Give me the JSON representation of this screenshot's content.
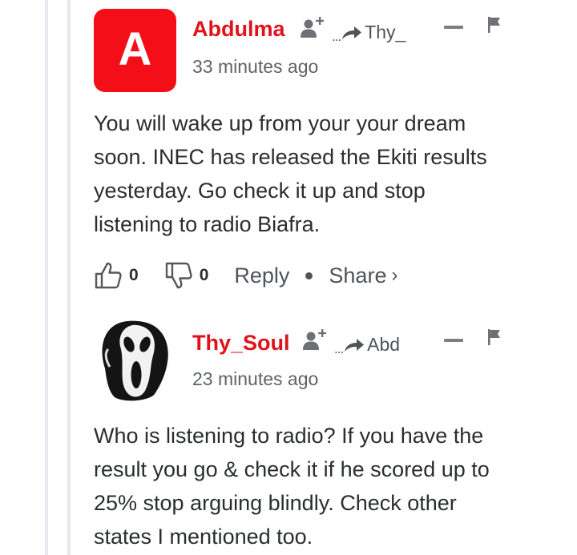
{
  "comments": [
    {
      "avatar_letter": "A",
      "username": "Abdulma",
      "reply_to": "Thy_",
      "timestamp": "33 minutes ago",
      "lines": [
        "You will wake up from your your dream",
        "soon. INEC has released the Ekiti results",
        "yesterday. Go check it up and stop",
        "listening to radio Biafra."
      ],
      "upvotes": "0",
      "downvotes": "0",
      "reply_label": "Reply",
      "share_label": "Share",
      "share_chevron": "›"
    },
    {
      "username": "Thy_Soul",
      "reply_to": "Abd",
      "timestamp": "23 minutes ago",
      "lines": [
        "Who is listening to radio? If you have the",
        "result you go & check it if he scored up to",
        "25% stop arguing blindly. Check other",
        "states I mentioned too."
      ]
    }
  ],
  "reply_dots": "...",
  "colors": {
    "username": "#e0121a",
    "avatar_bg": "#f30e18",
    "text": "#2a2e2e",
    "muted": "#5e6366"
  },
  "icons": [
    "follow-user-icon",
    "reply-arrow-icon",
    "collapse-icon",
    "flag-icon",
    "thumbs-up-icon",
    "thumbs-down-icon",
    "scream-mask-avatar"
  ]
}
